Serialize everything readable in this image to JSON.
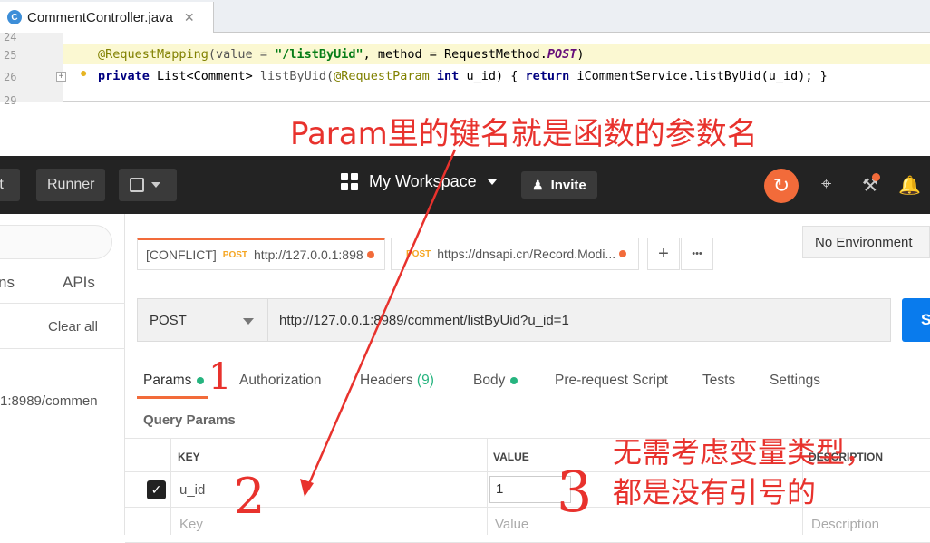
{
  "ide": {
    "tab_icon_letter": "C",
    "tab_title": "CommentController.java",
    "tab_close": "✕",
    "line_numbers": [
      "24",
      "25",
      "26",
      "29"
    ],
    "line25": {
      "annotation": "@RequestMapping",
      "p1": "(value = ",
      "path": "\"/listByUid\"",
      "p2": ", method = RequestMethod.",
      "post": "POST",
      "p3": ")"
    },
    "line26": {
      "private": "private",
      "t1": " List<Comment> ",
      "method": "listByUid(",
      "reqparam": "@RequestParam",
      "sp": " ",
      "int": "int",
      "t2": " u_id) { ",
      "return": "return",
      "t3": " iCommentService.listByUid(u_id); }"
    }
  },
  "annotations": {
    "top": "Param里的键名就是函数的参数名",
    "right_line1": "无需考虑变量类型，",
    "right_line2": "都是没有引号的",
    "num1": "1",
    "num2": "2",
    "num3": "3"
  },
  "postman": {
    "topbar": {
      "import_partial": "rt",
      "runner": "Runner",
      "new_icon": "plus-box-icon",
      "workspace": "My Workspace",
      "invite": "Invite"
    },
    "sidebar": {
      "tab_history_partial": "ns",
      "tab_apis": "APIs",
      "clear_all": "Clear all",
      "history_item": "1:8989/commen"
    },
    "tabs": [
      {
        "prefix": "[CONFLICT]",
        "method": "POST",
        "url": "http://127.0.0.1:898"
      },
      {
        "prefix": "",
        "method": "POST",
        "url": "https://dnsapi.cn/Record.Modi..."
      }
    ],
    "tab_plus": "+",
    "tab_more": "•••",
    "environment": "No Environment",
    "request": {
      "method": "POST",
      "url": "http://127.0.0.1:8989/comment/listByUid?u_id=1",
      "send_partial": "S"
    },
    "param_tabs": {
      "params": "Params",
      "authorization": "Authorization",
      "headers": "Headers",
      "headers_count": "(9)",
      "body": "Body",
      "prerequest": "Pre-request Script",
      "tests": "Tests",
      "settings": "Settings"
    },
    "query_params_title": "Query Params",
    "table": {
      "col_key": "KEY",
      "col_value": "VALUE",
      "col_description": "DESCRIPTION",
      "row1_key": "u_id",
      "row1_value": "1",
      "placeholder_key": "Key",
      "placeholder_value": "Value",
      "placeholder_description": "Description"
    }
  },
  "colors": {
    "accent_orange": "#f26b3a",
    "send_blue": "#097bed",
    "annotation_red": "#e8322d",
    "topbar_dark": "#232323"
  }
}
